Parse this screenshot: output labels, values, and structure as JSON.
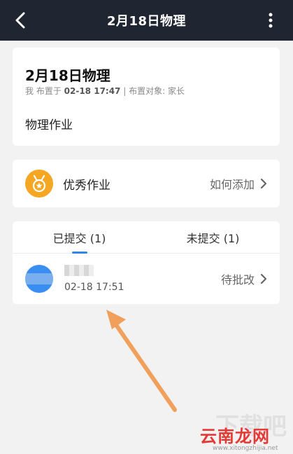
{
  "header": {
    "title": "2月18日物理"
  },
  "assignment": {
    "title": "2月18日物理",
    "meta_prefix": "我 布置于",
    "meta_time": "02-18 17:47",
    "meta_suffix": "| 布置对象: 家长",
    "content": "物理作业"
  },
  "excellent": {
    "label": "优秀作业",
    "action": "如何添加"
  },
  "tabs": [
    {
      "label": "已提交 (1)",
      "active": true
    },
    {
      "label": "未提交 (1)",
      "active": false
    }
  ],
  "submissions": [
    {
      "time": "02-18 17:51",
      "status": "待批改"
    }
  ],
  "watermark": {
    "main": "云南龙网",
    "sub": "www.xitongzhijia.net",
    "ghost": "下载吧"
  },
  "colors": {
    "topbar": "#1f2631",
    "accent": "#2f86e6",
    "badge": "#f5a623",
    "arrow": "#f0a05a"
  }
}
